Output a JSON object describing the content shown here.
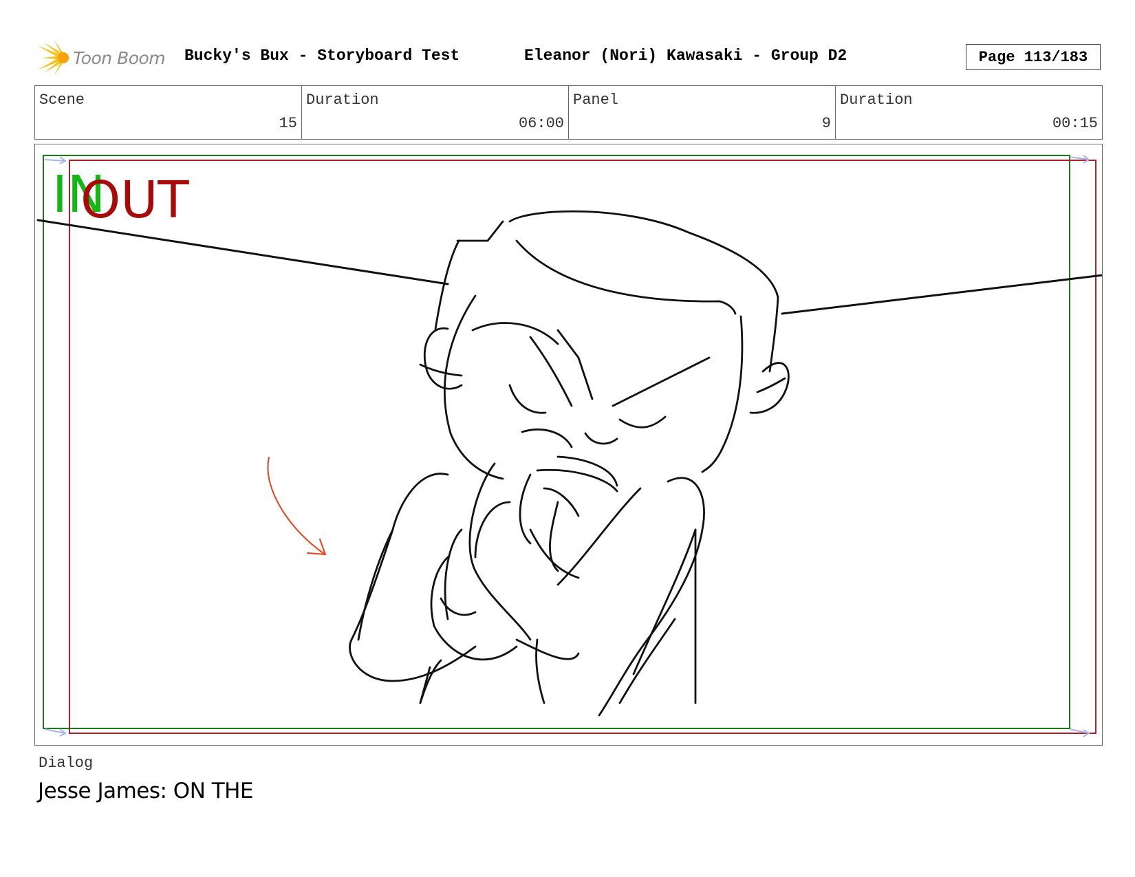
{
  "header": {
    "logo_text": "Toon Boom",
    "project_title": "Bucky's Bux - Storyboard Test",
    "artist": "Eleanor (Nori) Kawasaki - Group D2",
    "page": "Page 113/183"
  },
  "info": [
    {
      "label": "Scene",
      "value": "15"
    },
    {
      "label": "Duration",
      "value": "06:00"
    },
    {
      "label": "Panel",
      "value": "9"
    },
    {
      "label": "Duration",
      "value": "00:15"
    }
  ],
  "panel": {
    "in_label": "IN",
    "out_label": "OUT",
    "colors": {
      "in_frame": "#1a7a1a",
      "out_frame": "#b41e28",
      "in_text": "#14b814",
      "out_text": "#a80a0a",
      "arrow": "#e8401c"
    }
  },
  "dialog": {
    "label": "Dialog",
    "text": "Jesse James: ON THE"
  }
}
